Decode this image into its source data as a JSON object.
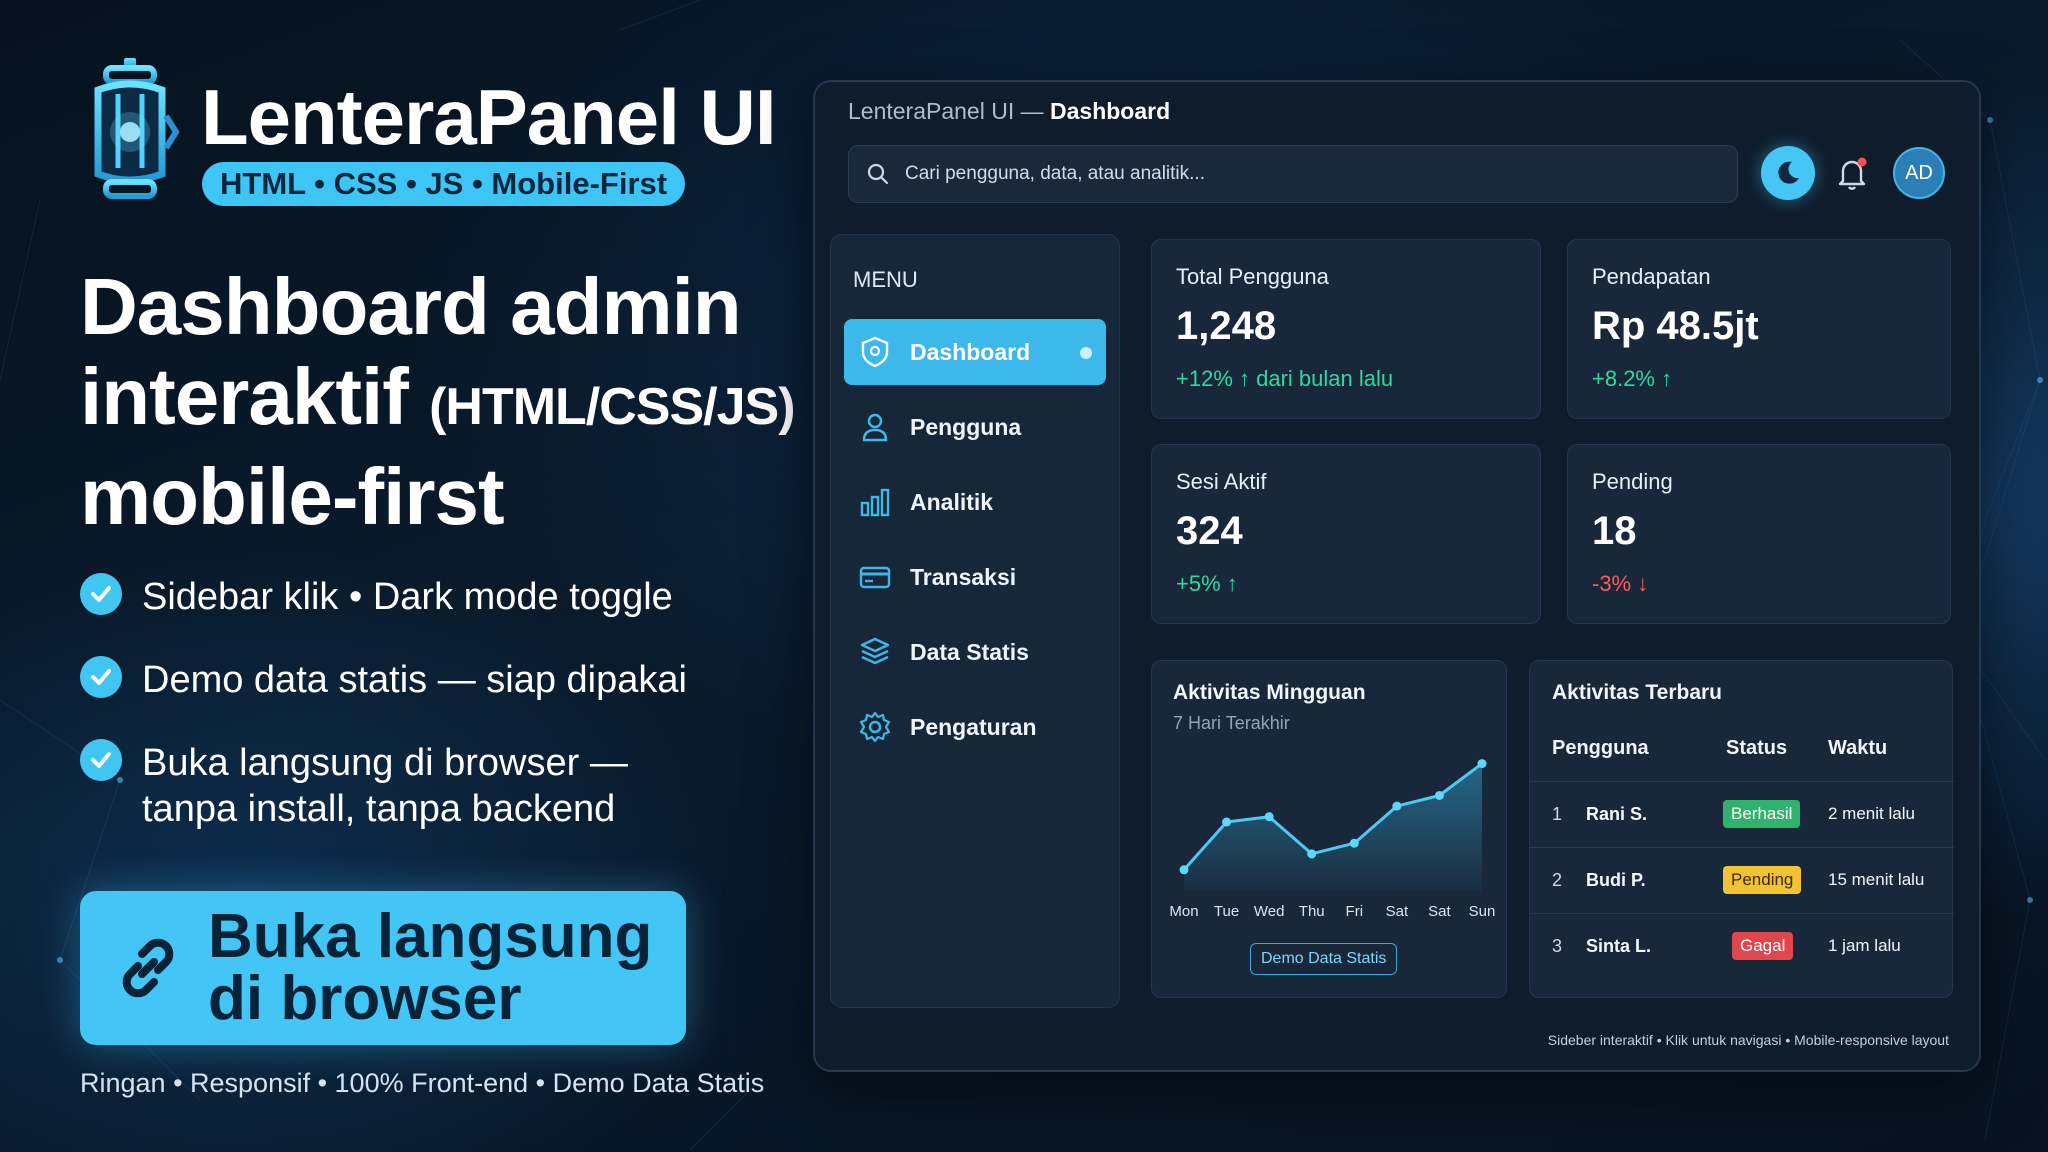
{
  "promo": {
    "brand_title": "LenteraPanel UI",
    "brand_tagline": "HTML • CSS • JS • Mobile-First",
    "headline_line1": "Dashboard admin",
    "headline_line2": "interaktif",
    "headline_line2_sub": "(HTML/CSS/JS)",
    "headline_line3": "mobile-first",
    "features": [
      {
        "text": "Sidebar klik • Dark mode toggle"
      },
      {
        "text": "Demo data statis — siap dipakai"
      },
      {
        "text": "Buka langsung di browser —",
        "text2": "tanpa install, tanpa backend"
      }
    ],
    "cta_line1": "Buka langsung",
    "cta_line2": "di browser",
    "footnote": "Ringan • Responsif • 100% Front-end • Demo Data Statis"
  },
  "app": {
    "title_prefix": "LenteraPanel UI — ",
    "title_page": "Dashboard",
    "search_placeholder": "Cari pengguna, data, atau analitik...",
    "avatar_initials": "AD",
    "menu_heading": "MENU",
    "nav": [
      {
        "label": "Dashboard",
        "icon": "shield-icon",
        "active": true
      },
      {
        "label": "Pengguna",
        "icon": "user-icon"
      },
      {
        "label": "Analitik",
        "icon": "bar-chart-icon"
      },
      {
        "label": "Transaksi",
        "icon": "credit-card-icon"
      },
      {
        "label": "Data Statis",
        "icon": "database-icon"
      },
      {
        "label": "Pengaturan",
        "icon": "gear-icon"
      }
    ],
    "stats": [
      {
        "label": "Total Pengguna",
        "value": "1,248",
        "delta": "+12% ↑ dari bulan lalu",
        "trend": "up"
      },
      {
        "label": "Pendapatan",
        "value": "Rp 48.5jt",
        "delta": "+8.2% ↑",
        "trend": "up"
      },
      {
        "label": "Sesi Aktif",
        "value": "324",
        "delta": "+5% ↑",
        "trend": "up"
      },
      {
        "label": "Pending",
        "value": "18",
        "delta": "-3% ↓",
        "trend": "down"
      }
    ],
    "chart_card": {
      "title": "Aktivitas Mingguan",
      "subtitle": "7 Hari Terakhir",
      "badge": "Demo Data Statis"
    },
    "activity": {
      "title": "Aktivitas Terbaru",
      "headers": [
        "Pengguna",
        "Status",
        "Waktu"
      ],
      "rows": [
        {
          "idx": "1",
          "name": "Rani S.",
          "status": "Berhasil",
          "kind": "ok",
          "time": "2 menit lalu"
        },
        {
          "idx": "2",
          "name": "Budi P.",
          "status": "Pending",
          "kind": "pend",
          "time": "15 menit lalu"
        },
        {
          "idx": "3",
          "name": "Sinta L.",
          "status": "Gagal",
          "kind": "fail",
          "time": "1 jam lalu"
        }
      ]
    },
    "footer": "Sideber interaktif • Klik untuk navigasi • Mobile-responsive layout"
  },
  "colors": {
    "accent": "#3cc5f5",
    "success": "#31d8a0",
    "danger": "#ff5a5a",
    "warning": "#f2c233"
  },
  "chart_data": {
    "type": "line",
    "categories": [
      "Mon",
      "Tue",
      "Wed",
      "Thu",
      "Fri",
      "Sat",
      "Sat",
      "Sun"
    ],
    "series": [
      {
        "values": [
          2,
          6.5,
          7,
          3.5,
          4.5,
          8,
          9,
          12
        ]
      }
    ],
    "ylim": [
      0,
      13
    ],
    "grid": false
  }
}
